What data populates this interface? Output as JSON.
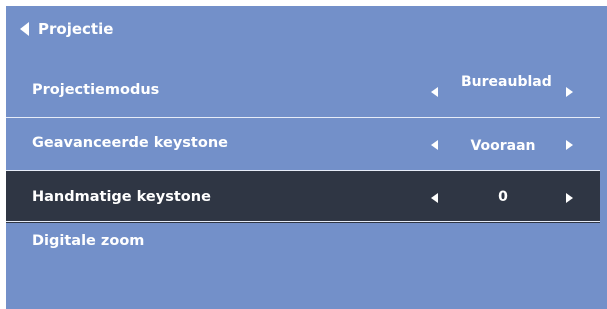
{
  "menu": {
    "title": "Projectie",
    "items": [
      {
        "label": "Projectiemodus",
        "value": "Bureaublad"
      },
      {
        "label": "Geavanceerde keystone",
        "value": "Vooraan"
      },
      {
        "label": "Handmatige keystone",
        "value": "0"
      },
      {
        "label": "Digitale zoom"
      }
    ],
    "selected_item": "Handmatige keystone"
  },
  "colors": {
    "panel_background": "#7390c9",
    "selected_row_background": "#2f3644",
    "text": "#ffffff",
    "divider": "#e6ecf7"
  },
  "icons": {
    "back": "back-triangle-icon",
    "decrease": "left-triangle-icon",
    "increase": "right-triangle-icon"
  }
}
